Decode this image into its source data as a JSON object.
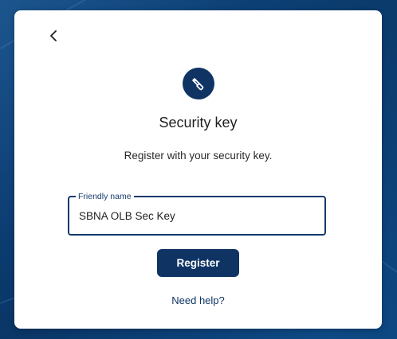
{
  "header": {
    "back_icon": "chevron-left-icon"
  },
  "badge": {
    "icon": "security-key-icon"
  },
  "main": {
    "title": "Security key",
    "subtitle": "Register with your security key."
  },
  "form": {
    "friendly_name_label": "Friendly name",
    "friendly_name_value": "SBNA OLB Sec Key"
  },
  "actions": {
    "register_label": "Register",
    "help_label": "Need help?"
  },
  "colors": {
    "brand_navy": "#0f3464",
    "background_blue": "#0b3a6b"
  }
}
